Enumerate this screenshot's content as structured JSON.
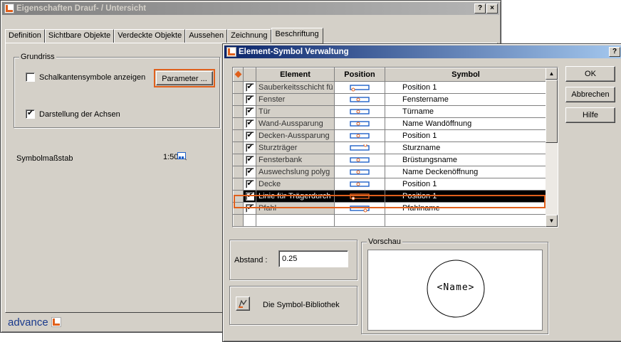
{
  "back_window": {
    "title": "Eigenschaften Drauf- / Untersicht",
    "help_btn": "?",
    "close_btn": "×",
    "tabs": [
      "Definition",
      "Sichtbare Objekte",
      "Verdeckte Objekte",
      "Aussehen",
      "Zeichnung",
      "Beschriftung"
    ],
    "active_tab": "Beschriftung",
    "group_label": "Grundriss",
    "checkbox_schalkanten": "Schalkantensymbole anzeigen",
    "checkbox_schalkanten_checked": false,
    "parameter_button": "Parameter ...",
    "checkbox_achsen": "Darstellung der Achsen",
    "checkbox_achsen_checked": true,
    "symbolmassstab_label": "Symbolmaßstab",
    "symbolmassstab_value": "1:50",
    "footer_logo": "advance"
  },
  "dialog": {
    "title": "Element-Symbol Verwaltung",
    "help_btn": "?",
    "close_btn": "×",
    "columns": [
      "Element",
      "Position",
      "Symbol"
    ],
    "rows": [
      {
        "element": "Sauberkeitsschicht fü",
        "symbol": "Position 1",
        "checked": true,
        "pos": "bottom-left",
        "selected": false
      },
      {
        "element": "Fenster",
        "symbol": "Fenstername",
        "checked": true,
        "pos": "center",
        "selected": false
      },
      {
        "element": "Tür",
        "symbol": "Türname",
        "checked": true,
        "pos": "center",
        "selected": false
      },
      {
        "element": "Wand-Aussparung",
        "symbol": "Name Wandöffnung",
        "checked": true,
        "pos": "center",
        "selected": false
      },
      {
        "element": "Decken-Aussparung",
        "symbol": "Position 1",
        "checked": true,
        "pos": "center",
        "selected": false
      },
      {
        "element": "Sturzträger",
        "symbol": "Sturzname",
        "checked": true,
        "pos": "top-right",
        "selected": false
      },
      {
        "element": "Fensterbank",
        "symbol": "Brüstungsname",
        "checked": true,
        "pos": "center",
        "selected": false
      },
      {
        "element": "Auswechslung polyg",
        "symbol": "Name Deckenöffnung",
        "checked": true,
        "pos": "center",
        "selected": false
      },
      {
        "element": "Decke",
        "symbol": "Position 1",
        "checked": true,
        "pos": "center",
        "selected": false
      },
      {
        "element": "Linie für Trägerdurch",
        "symbol": "Position 1",
        "checked": true,
        "pos": "bottom-left",
        "selected": true
      },
      {
        "element": "Pfahl",
        "symbol": "Pfahlname",
        "checked": true,
        "pos": "bottom-right",
        "selected": false
      }
    ],
    "ok_button": "OK",
    "cancel_button": "Abbrechen",
    "help_button": "Hilfe",
    "abstand_label": "Abstand :",
    "abstand_value": "0.25",
    "library_button": "Die Symbol-Bibliothek",
    "preview_label": "Vorschau",
    "preview_text": "<Name>",
    "colors": {
      "accent": "#e0601c",
      "title_bar": "#0a246a",
      "icon_blue": "#2060c8"
    }
  }
}
